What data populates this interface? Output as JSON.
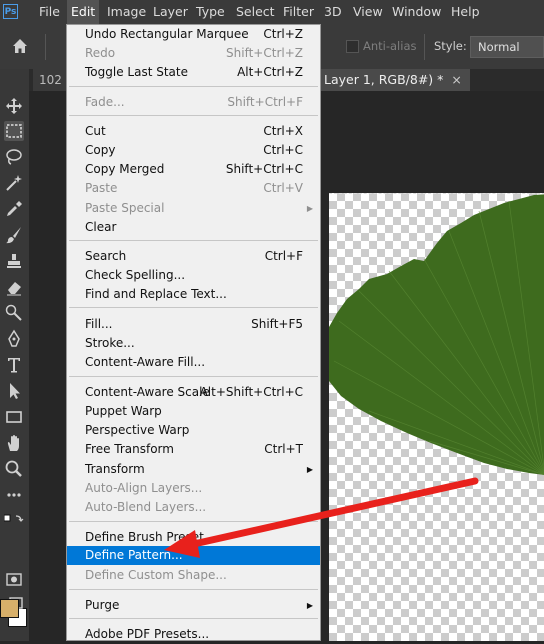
{
  "app": {
    "logo": "Ps"
  },
  "menubar": {
    "items": [
      "File",
      "Edit",
      "Image",
      "Layer",
      "Type",
      "Select",
      "Filter",
      "3D",
      "View",
      "Window",
      "Help"
    ],
    "active": "Edit"
  },
  "options_bar": {
    "anti_alias_label": "Anti-alias",
    "style_label": "Style:",
    "style_value": "Normal"
  },
  "tabs": {
    "tab1": "102",
    "tab2": "Layer 1, RGB/8#) *",
    "tab2_close": "×"
  },
  "colors": {
    "foreground": "#d8b06a",
    "background": "#ffffff",
    "highlight": "#0078d7",
    "arrow": "#e8211c"
  },
  "edit_menu": {
    "sections": [
      [
        {
          "label": "Undo Rectangular Marquee",
          "shortcut": "Ctrl+Z",
          "disabled": false
        },
        {
          "label": "Redo",
          "shortcut": "Shift+Ctrl+Z",
          "disabled": true
        },
        {
          "label": "Toggle Last State",
          "shortcut": "Alt+Ctrl+Z",
          "disabled": false
        }
      ],
      [
        {
          "label": "Fade...",
          "shortcut": "Shift+Ctrl+F",
          "disabled": true
        }
      ],
      [
        {
          "label": "Cut",
          "shortcut": "Ctrl+X",
          "disabled": false
        },
        {
          "label": "Copy",
          "shortcut": "Ctrl+C",
          "disabled": false
        },
        {
          "label": "Copy Merged",
          "shortcut": "Shift+Ctrl+C",
          "disabled": false
        },
        {
          "label": "Paste",
          "shortcut": "Ctrl+V",
          "disabled": true
        },
        {
          "label": "Paste Special",
          "shortcut": "",
          "disabled": true,
          "submenu": true
        },
        {
          "label": "Clear",
          "shortcut": "",
          "disabled": false
        }
      ],
      [
        {
          "label": "Search",
          "shortcut": "Ctrl+F",
          "disabled": false
        },
        {
          "label": "Check Spelling...",
          "shortcut": "",
          "disabled": false
        },
        {
          "label": "Find and Replace Text...",
          "shortcut": "",
          "disabled": false
        }
      ],
      [
        {
          "label": "Fill...",
          "shortcut": "Shift+F5",
          "disabled": false
        },
        {
          "label": "Stroke...",
          "shortcut": "",
          "disabled": false
        },
        {
          "label": "Content-Aware Fill...",
          "shortcut": "",
          "disabled": false
        }
      ],
      [
        {
          "label": "Content-Aware Scale",
          "shortcut": "Alt+Shift+Ctrl+C",
          "disabled": false
        },
        {
          "label": "Puppet Warp",
          "shortcut": "",
          "disabled": false
        },
        {
          "label": "Perspective Warp",
          "shortcut": "",
          "disabled": false
        },
        {
          "label": "Free Transform",
          "shortcut": "Ctrl+T",
          "disabled": false
        },
        {
          "label": "Transform",
          "shortcut": "",
          "disabled": false,
          "submenu": true
        },
        {
          "label": "Auto-Align Layers...",
          "shortcut": "",
          "disabled": true
        },
        {
          "label": "Auto-Blend Layers...",
          "shortcut": "",
          "disabled": true
        }
      ],
      [
        {
          "label": "Define Brush Preset...",
          "shortcut": "",
          "disabled": false
        },
        {
          "label": "Define Pattern...",
          "shortcut": "",
          "disabled": false,
          "highlighted": true
        },
        {
          "label": "Define Custom Shape...",
          "shortcut": "",
          "disabled": true
        }
      ],
      [
        {
          "label": "Purge",
          "shortcut": "",
          "disabled": false,
          "submenu": true
        }
      ],
      [
        {
          "label": "Adobe PDF Presets...",
          "shortcut": "",
          "disabled": false
        }
      ]
    ]
  },
  "tools": [
    "move-tool",
    "marquee-tool",
    "lasso-tool",
    "magic-wand-tool",
    "eyedropper-tool",
    "brush-tool",
    "stamp-tool",
    "eraser-tool",
    "dodge-tool",
    "pen-tool",
    "type-tool",
    "path-selection-tool",
    "rectangle-tool",
    "hand-tool",
    "zoom-tool",
    "more-tools",
    "swap-colors",
    "quick-mask",
    "screen-mode"
  ]
}
